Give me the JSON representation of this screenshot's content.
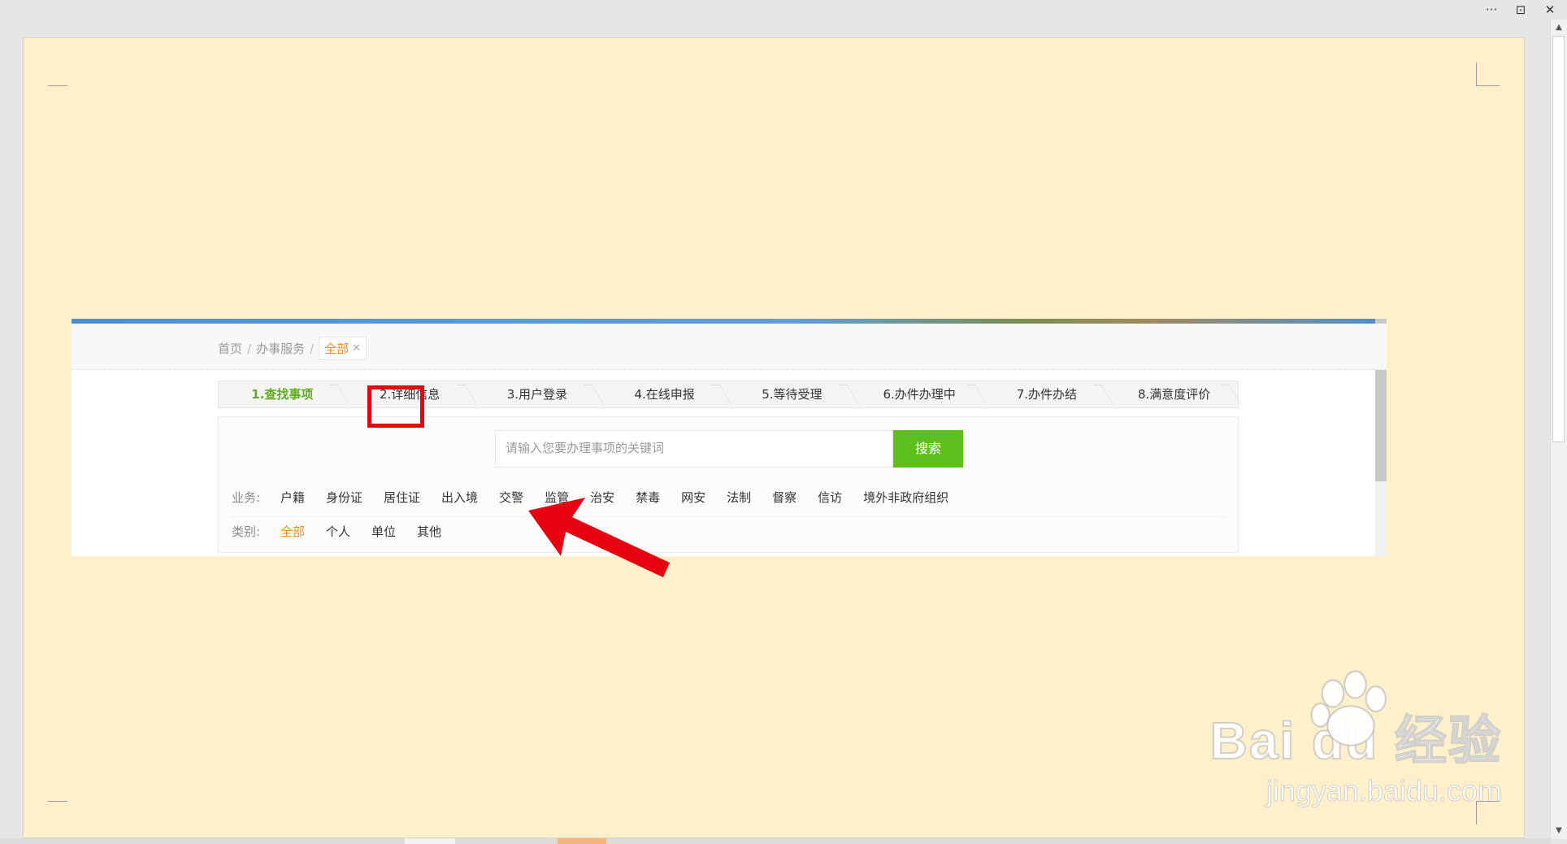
{
  "window": {
    "controls": {
      "more": "···",
      "restore": "⊡",
      "close": "✕"
    }
  },
  "breadcrumb": {
    "items": [
      "首页",
      "办事服务"
    ],
    "separator": "/",
    "active": "全部",
    "active_close": "✕"
  },
  "steps": [
    "1.查找事项",
    "2.详细信息",
    "3.用户登录",
    "4.在线申报",
    "5.等待受理",
    "6.办件办理中",
    "7.办件办结",
    "8.满意度评价"
  ],
  "search": {
    "placeholder": "请输入您要办理事项的关键词",
    "button_label": "搜索"
  },
  "filters": {
    "business_label": "业务:",
    "business_items": [
      "户籍",
      "身份证",
      "居住证",
      "出入境",
      "交警",
      "监管",
      "治安",
      "禁毒",
      "网安",
      "法制",
      "督察",
      "信访",
      "境外非政府组织"
    ],
    "category_label": "类别:",
    "category_items": [
      "全部",
      "个人",
      "单位",
      "其他"
    ],
    "category_selected": "全部",
    "highlighted_business": "出入境"
  },
  "watermark": {
    "brand": "Bai du 经验",
    "url": "jingyan.baidu.com"
  },
  "colors": {
    "accent_green": "#5ebf1c",
    "accent_orange": "#f08a24",
    "highlight_red": "#e50012",
    "page_bg": "#fff0cc"
  }
}
